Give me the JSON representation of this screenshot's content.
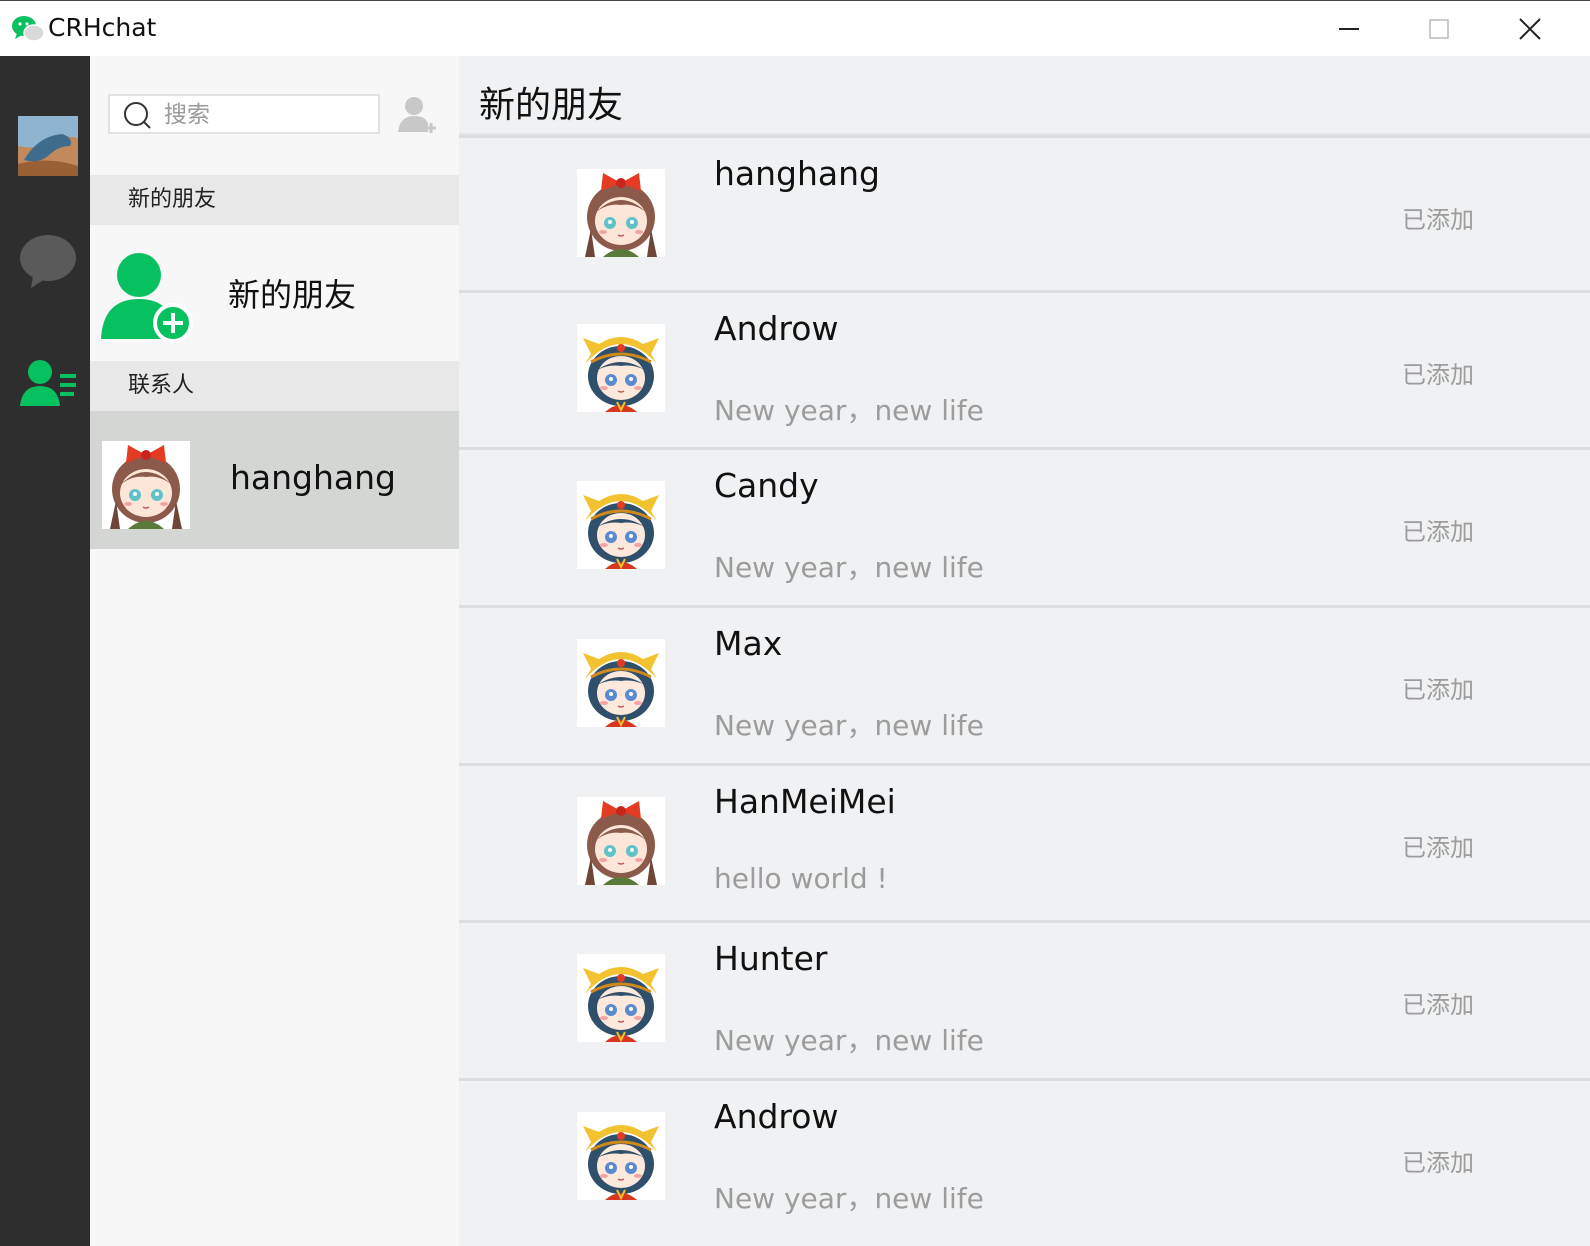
{
  "window": {
    "title": "CRHchat",
    "controls": [
      "minimize-icon",
      "maximize-icon",
      "close-icon"
    ]
  },
  "rail": {
    "items": [
      {
        "name": "user-avatar"
      },
      {
        "name": "chat-icon",
        "color": "#5a5a5a"
      },
      {
        "name": "contacts-icon",
        "color": "#07c160",
        "active": true
      }
    ]
  },
  "search": {
    "placeholder": "搜索",
    "value": ""
  },
  "list": {
    "section_new": "新的朋友",
    "new_friends_label": "新的朋友",
    "section_contacts": "联系人",
    "contacts": [
      {
        "name": "hanghang",
        "avatar": "girl-red-bow-avatar"
      }
    ]
  },
  "content": {
    "title": "新的朋友",
    "requests": [
      {
        "name": "hanghang",
        "message": "",
        "status": "已添加",
        "avatar": "girl-red-bow-avatar"
      },
      {
        "name": "Androw",
        "message": "New year，new life",
        "status": "已添加",
        "avatar": "girl-yellow-hat-avatar"
      },
      {
        "name": "Candy",
        "message": "New year，new life",
        "status": "已添加",
        "avatar": "girl-yellow-hat-avatar"
      },
      {
        "name": "Max",
        "message": "New year，new life",
        "status": "已添加",
        "avatar": "girl-yellow-hat-avatar"
      },
      {
        "name": "HanMeiMei",
        "message": "hello world !",
        "status": "已添加",
        "avatar": "girl-red-bow-avatar"
      },
      {
        "name": "Hunter",
        "message": "New year，new life",
        "status": "已添加",
        "avatar": "girl-yellow-hat-avatar"
      },
      {
        "name": "Androw",
        "message": "New year，new life",
        "status": "已添加",
        "avatar": "girl-yellow-hat-avatar"
      }
    ]
  },
  "colors": {
    "accent": "#07c160",
    "rail_bg": "#2e2e2e",
    "selected_bg": "#d3d6d3",
    "muted_text": "#9c9c9c"
  }
}
